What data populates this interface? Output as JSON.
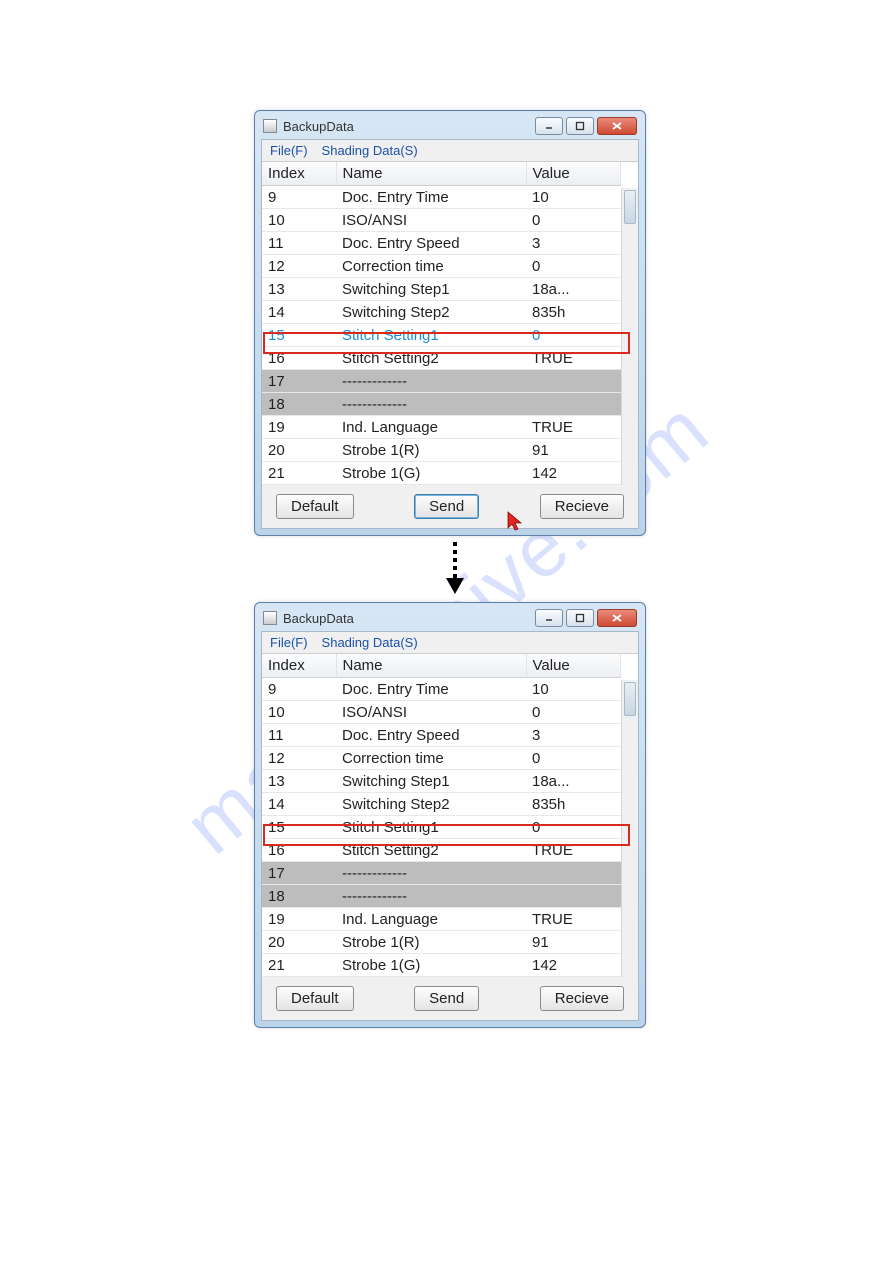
{
  "watermark": "manualshive.com",
  "window": {
    "title": "BackupData",
    "menus": {
      "file": "File(F)",
      "shading": "Shading Data(S)"
    },
    "headers": {
      "index": "Index",
      "name": "Name",
      "value": "Value"
    },
    "buttons": {
      "default": "Default",
      "send": "Send",
      "recieve": "Recieve"
    },
    "rows": [
      {
        "idx": "9",
        "name": "Doc. Entry Time",
        "val": "10"
      },
      {
        "idx": "10",
        "name": "ISO/ANSI",
        "val": "0"
      },
      {
        "idx": "11",
        "name": "Doc. Entry Speed",
        "val": "3"
      },
      {
        "idx": "12",
        "name": "Correction time",
        "val": "0"
      },
      {
        "idx": "13",
        "name": "Switching Step1",
        "val": "18a..."
      },
      {
        "idx": "14",
        "name": "Switching Step2",
        "val": "835h"
      },
      {
        "idx": "15",
        "name": "Stitch Setting1",
        "val": "0"
      },
      {
        "idx": "16",
        "name": "Stitch Setting2",
        "val": "TRUE"
      },
      {
        "idx": "17",
        "name": "-------------",
        "val": ""
      },
      {
        "idx": "18",
        "name": "-------------",
        "val": ""
      },
      {
        "idx": "19",
        "name": "Ind. Language",
        "val": "TRUE"
      },
      {
        "idx": "20",
        "name": "Strobe 1(R)",
        "val": "91"
      },
      {
        "idx": "21",
        "name": "Strobe 1(G)",
        "val": "142"
      }
    ]
  }
}
